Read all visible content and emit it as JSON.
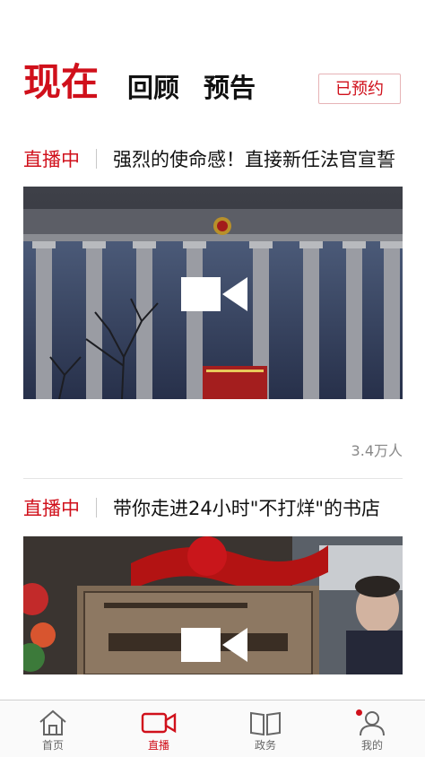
{
  "header": {
    "tabs": [
      {
        "label": "现在",
        "active": true
      },
      {
        "label": "回顾",
        "active": false
      },
      {
        "label": "预告",
        "active": false
      }
    ],
    "reserved_button": "已预约"
  },
  "cards": [
    {
      "badge": "直播中",
      "title": "强烈的使命感！直接新任法官宣誓",
      "views": "3.4万人",
      "thumbnail_icon": "video-camera-icon"
    },
    {
      "badge": "直播中",
      "title": "带你走进24小时\"不打烊\"的书店",
      "thumbnail_icon": "video-camera-icon"
    }
  ],
  "bottom_nav": {
    "items": [
      {
        "label": "首页",
        "icon": "home-icon",
        "active": false
      },
      {
        "label": "直播",
        "icon": "video-icon",
        "active": true
      },
      {
        "label": "政务",
        "icon": "book-icon",
        "active": false
      },
      {
        "label": "我的",
        "icon": "profile-icon",
        "active": false,
        "badge_dot": true
      }
    ]
  },
  "colors": {
    "accent": "#d0101b",
    "text": "#111111",
    "muted": "#888888"
  }
}
